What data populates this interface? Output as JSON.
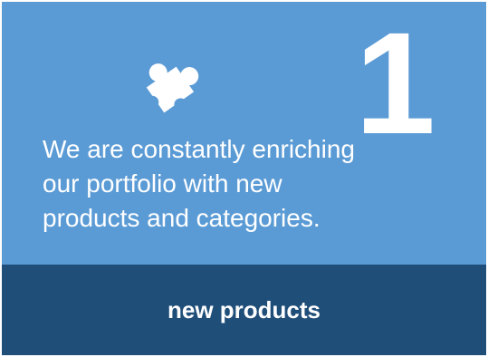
{
  "card": {
    "number": "1",
    "icon": "puzzle-piece-icon",
    "description": "We are constantly  enriching\nour portfolio with new\nproducts and categories.",
    "cta_label": "new products"
  },
  "colors": {
    "top_panel": "#5b9bd5",
    "bottom_panel": "#1f4e79",
    "text": "#ffffff"
  }
}
